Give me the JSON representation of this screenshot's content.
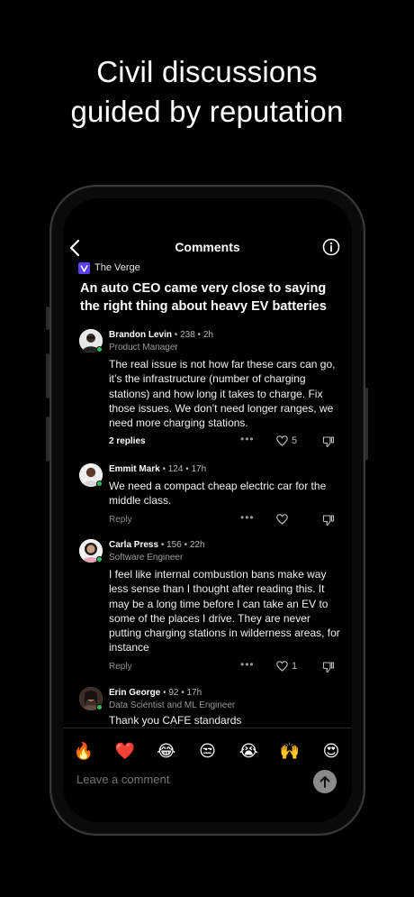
{
  "headline": {
    "line1": "Civil discussions",
    "line2": "guided by reputation"
  },
  "nav": {
    "title": "Comments",
    "back_icon": "chevron-left-icon",
    "info_icon": "info-circle-icon"
  },
  "article": {
    "source": "The Verge",
    "source_color": "#5b3ef0",
    "title": "An auto CEO came very close to saying the right thing about heavy EV batteries"
  },
  "comments": [
    {
      "name": "Brandon Levin",
      "score": "238",
      "time": "2h",
      "role": "Product Manager",
      "text": "The real issue is not how far these cars can go, it’s the infrastructure (number of charging stations) and how long it takes to charge. Fix those issues. We don’t need longer ranges, we need more charging stations.",
      "action_label": "2 replies",
      "likes": "5",
      "online": true
    },
    {
      "name": "Emmit Mark",
      "score": "124",
      "time": "17h",
      "role": "",
      "text": "We need a compact cheap electric car for the middle class.",
      "action_label": "Reply",
      "likes": "",
      "online": true
    },
    {
      "name": "Carla Press",
      "score": "156",
      "time": "22h",
      "role": "Software Engineer",
      "text": "I feel like internal combustion bans make way less sense than I thought after reading this.  It may be a long time before I can take an EV to some of the places I drive.  They are never putting charging stations in wilderness areas, for instance",
      "action_label": "Reply",
      "likes": "1",
      "online": true
    },
    {
      "name": "Erin George",
      "score": "92",
      "time": "17h",
      "role": "Data Scientist and ML Engineer",
      "text": "Thank you CAFE standards",
      "action_label": "",
      "likes": "",
      "online": true
    }
  ],
  "meta_separator": " • ",
  "reactions": [
    "🔥",
    "❤️",
    "😂",
    "😒",
    "😭",
    "🙌",
    "😍"
  ],
  "input": {
    "placeholder": "Leave a comment"
  },
  "colors": {
    "online": "#2fbf56",
    "background": "#000000"
  }
}
